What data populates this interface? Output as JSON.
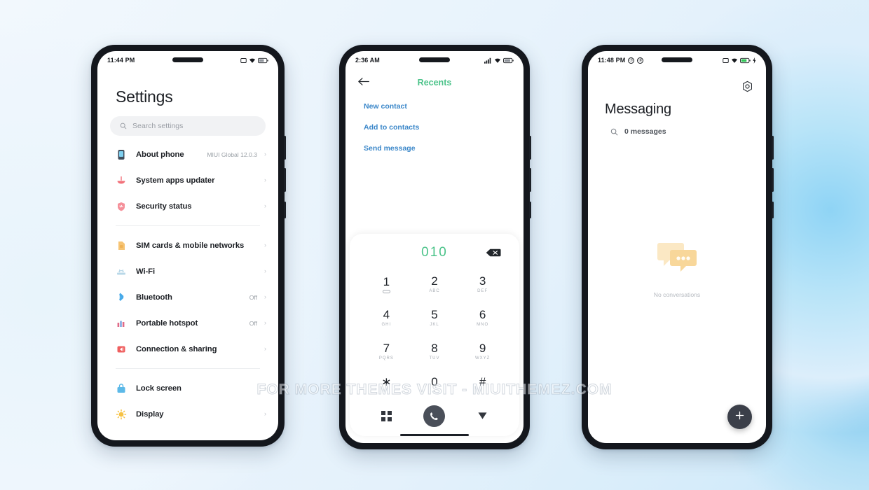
{
  "background": {
    "base_color": "#eaf4fc",
    "accent_color": "#8fd4f5"
  },
  "watermark": {
    "text": "FOR MORE THEMES VISIT - MIUITHEMEZ.COM"
  },
  "phones": {
    "settings": {
      "status_bar": {
        "time": "11:44 PM",
        "icons": [
          "sim-card-icon",
          "wifi-icon",
          "battery-icon"
        ]
      },
      "title": "Settings",
      "search": {
        "placeholder": "Search settings",
        "icon": "search-icon"
      },
      "groups": [
        {
          "items": [
            {
              "label": "About phone",
              "value": "MIUI Global 12.0.3",
              "icon": "about-phone-icon",
              "color": "#4a5968",
              "chevron": "›"
            },
            {
              "label": "System apps updater",
              "value": "",
              "icon": "system-updater-icon",
              "color": "#f06a72",
              "chevron": "›"
            },
            {
              "label": "Security status",
              "value": "",
              "icon": "security-status-icon",
              "color": "#f4808a",
              "chevron": "›"
            }
          ]
        },
        {
          "items": [
            {
              "label": "SIM cards & mobile networks",
              "value": "",
              "icon": "sim-cards-icon",
              "color": "#f5c06a",
              "chevron": "›"
            },
            {
              "label": "Wi-Fi",
              "value": "",
              "icon": "wifi-settings-icon",
              "color": "#a8cfe4",
              "chevron": "›"
            },
            {
              "label": "Bluetooth",
              "value": "Off",
              "icon": "bluetooth-icon",
              "color": "#4aa8e8",
              "chevron": "›"
            },
            {
              "label": "Portable hotspot",
              "value": "Off",
              "icon": "hotspot-icon",
              "color": "#d96a8a",
              "chevron": "›"
            },
            {
              "label": "Connection & sharing",
              "value": "",
              "icon": "connection-sharing-icon",
              "color": "#ef5d5d",
              "chevron": "›"
            }
          ]
        },
        {
          "items": [
            {
              "label": "Lock screen",
              "value": "",
              "icon": "lock-screen-icon",
              "color": "#5bb8e8",
              "chevron": "›"
            },
            {
              "label": "Display",
              "value": "",
              "icon": "display-icon",
              "color": "#f5c043",
              "chevron": "›"
            }
          ]
        }
      ]
    },
    "dialer": {
      "status_bar": {
        "time": "2:36 AM",
        "icons": [
          "signal-icon",
          "wifi-icon",
          "battery-icon"
        ]
      },
      "header": {
        "back_icon": "back-arrow-icon",
        "title": "Recents",
        "title_color": "#4cc38a"
      },
      "links": [
        {
          "label": "New contact"
        },
        {
          "label": "Add to contacts"
        },
        {
          "label": "Send message"
        }
      ],
      "link_color": "#3b87c9",
      "dialed_number": "010",
      "backspace_icon": "backspace-icon",
      "keys": [
        {
          "digit": "1",
          "letters": "",
          "voicemail": true
        },
        {
          "digit": "2",
          "letters": "ABC"
        },
        {
          "digit": "3",
          "letters": "DEF"
        },
        {
          "digit": "4",
          "letters": "GHI"
        },
        {
          "digit": "5",
          "letters": "JKL"
        },
        {
          "digit": "6",
          "letters": "MNO"
        },
        {
          "digit": "7",
          "letters": "PQRS"
        },
        {
          "digit": "8",
          "letters": "TUV"
        },
        {
          "digit": "9",
          "letters": "WXYZ"
        },
        {
          "digit": "∗",
          "letters": ""
        },
        {
          "digit": "0",
          "letters": "+"
        },
        {
          "digit": "#",
          "letters": ""
        }
      ],
      "actions": {
        "keypad_grid_icon": "apps-grid-icon",
        "call_icon": "call-icon",
        "collapse_icon": "chevron-down-icon"
      }
    },
    "messaging": {
      "status_bar": {
        "time": "11:48 PM",
        "badge1": "⑦",
        "badge2": "⑧",
        "icons": [
          "sim-card-icon",
          "wifi-icon",
          "battery-charging-icon",
          "bolt-icon"
        ],
        "battery_color": "#34c759"
      },
      "settings_icon": "gear-icon",
      "title": "Messaging",
      "search": {
        "text": "0 messages",
        "icon": "search-icon"
      },
      "empty_state": {
        "illustration": "chat-bubbles-icon",
        "text": "No conversations",
        "color": "#fbe2b0"
      },
      "fab": {
        "icon": "plus-icon",
        "label": "+"
      }
    }
  }
}
